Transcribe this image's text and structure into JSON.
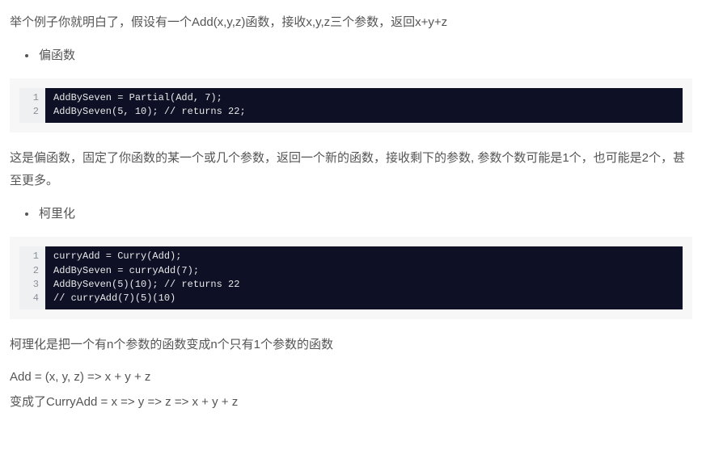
{
  "intro": "举个例子你就明白了，假设有一个Add(x,y,z)函数，接收x,y,z三个参数，返回x+y+z",
  "bullets": {
    "partial": "偏函数",
    "curry": "柯里化"
  },
  "code1": {
    "lines": [
      "AddBySeven = Partial(Add, 7);",
      "AddBySeven(5, 10); // returns 22;"
    ]
  },
  "partial_explain": "这是偏函数，固定了你函数的某一个或几个参数，返回一个新的函数，接收剩下的参数, 参数个数可能是1个，也可能是2个，甚至更多。",
  "code2": {
    "lines": [
      "curryAdd = Curry(Add);",
      "AddBySeven = curryAdd(7);",
      "AddBySeven(5)(10); // returns 22",
      "// curryAdd(7)(5)(10)"
    ]
  },
  "curry_explain": "柯理化是把一个有n个参数的函数变成n个只有1个参数的函数",
  "formula1": "Add = (x, y, z) => x + y + z",
  "formula2": "变成了CurryAdd = x => y => z => x + y + z"
}
